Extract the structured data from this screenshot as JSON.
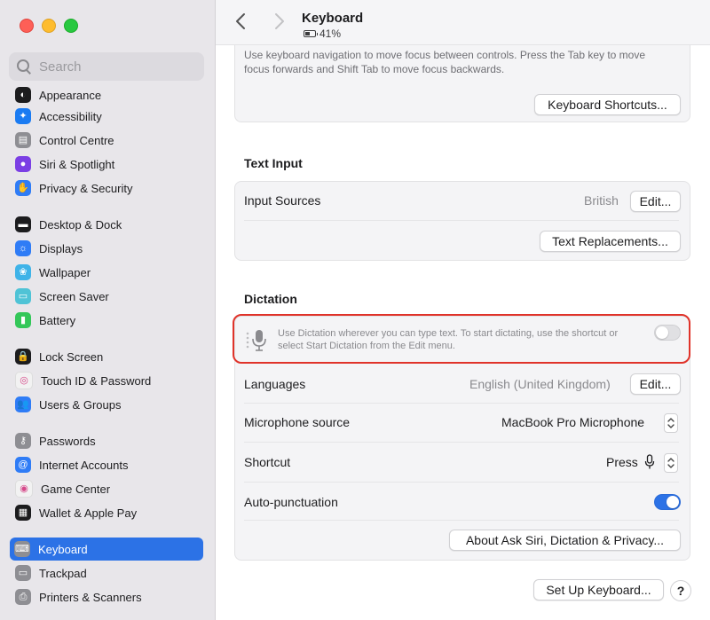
{
  "window": {
    "title": "Keyboard",
    "battery": "41%"
  },
  "search": {
    "placeholder": "Search"
  },
  "sidebar": {
    "items": [
      {
        "label": "Appearance",
        "icon": "appearance-icon",
        "color": "#1c1c1e",
        "glyph": "◐"
      },
      {
        "label": "Accessibility",
        "icon": "accessibility-icon",
        "color": "#1a7bf2",
        "glyph": "✦"
      },
      {
        "label": "Control Centre",
        "icon": "control-centre-icon",
        "color": "#8e8e93",
        "glyph": "▤"
      },
      {
        "label": "Siri & Spotlight",
        "icon": "siri-icon",
        "color": "#7b3fe4",
        "glyph": "●"
      },
      {
        "label": "Privacy & Security",
        "icon": "hand-icon",
        "color": "#2f7cf6",
        "glyph": "✋"
      },
      {
        "label": "Desktop & Dock",
        "icon": "dock-icon",
        "color": "#1c1c1e",
        "glyph": "▬"
      },
      {
        "label": "Displays",
        "icon": "displays-icon",
        "color": "#2f7cf6",
        "glyph": "☼"
      },
      {
        "label": "Wallpaper",
        "icon": "wallpaper-icon",
        "color": "#3fb3e8",
        "glyph": "❀"
      },
      {
        "label": "Screen Saver",
        "icon": "screen-saver-icon",
        "color": "#4fc3d6",
        "glyph": "▭"
      },
      {
        "label": "Battery",
        "icon": "battery-icon",
        "color": "#34c759",
        "glyph": "▮"
      },
      {
        "label": "Lock Screen",
        "icon": "lock-icon",
        "color": "#1c1c1e",
        "glyph": "🔒"
      },
      {
        "label": "Touch ID & Password",
        "icon": "fingerprint-icon",
        "color": "#f2f2f2",
        "glyph": "◎"
      },
      {
        "label": "Users & Groups",
        "icon": "users-icon",
        "color": "#2f7cf6",
        "glyph": "👥"
      },
      {
        "label": "Passwords",
        "icon": "key-icon",
        "color": "#8e8e93",
        "glyph": "⚷"
      },
      {
        "label": "Internet Accounts",
        "icon": "at-icon",
        "color": "#2f7cf6",
        "glyph": "@"
      },
      {
        "label": "Game Center",
        "icon": "game-center-icon",
        "color": "#f2f2f2",
        "glyph": "◉"
      },
      {
        "label": "Wallet & Apple Pay",
        "icon": "wallet-icon",
        "color": "#1c1c1e",
        "glyph": "▦"
      },
      {
        "label": "Keyboard",
        "icon": "keyboard-icon",
        "color": "#8e8e93",
        "glyph": "⌨",
        "selected": true
      },
      {
        "label": "Trackpad",
        "icon": "trackpad-icon",
        "color": "#8e8e93",
        "glyph": "▭"
      },
      {
        "label": "Printers & Scanners",
        "icon": "printer-icon",
        "color": "#8e8e93",
        "glyph": "⎙"
      }
    ]
  },
  "navigation": {
    "help_text": "Use keyboard navigation to move focus between controls. Press the Tab key to move focus forwards and Shift Tab to move focus backwards.",
    "shortcuts_button": "Keyboard Shortcuts..."
  },
  "text_input": {
    "title": "Text Input",
    "input_sources_label": "Input Sources",
    "input_sources_value": "British",
    "edit_button": "Edit...",
    "text_replacements_button": "Text Replacements..."
  },
  "dictation": {
    "title": "Dictation",
    "description": "Use Dictation wherever you can type text. To start dictating, use the shortcut or select Start Dictation from the Edit menu.",
    "enabled": false,
    "languages_label": "Languages",
    "languages_value": "English (United Kingdom)",
    "languages_edit": "Edit...",
    "mic_label": "Microphone source",
    "mic_value": "MacBook Pro Microphone",
    "shortcut_label": "Shortcut",
    "shortcut_value": "Press",
    "autopunct_label": "Auto-punctuation",
    "autopunct_enabled": true,
    "about_button": "About Ask Siri, Dictation & Privacy..."
  },
  "footer": {
    "setup_button": "Set Up Keyboard...",
    "help_button": "?"
  },
  "colors": {
    "accent": "#2c72e6",
    "highlight": "#e0332a"
  }
}
